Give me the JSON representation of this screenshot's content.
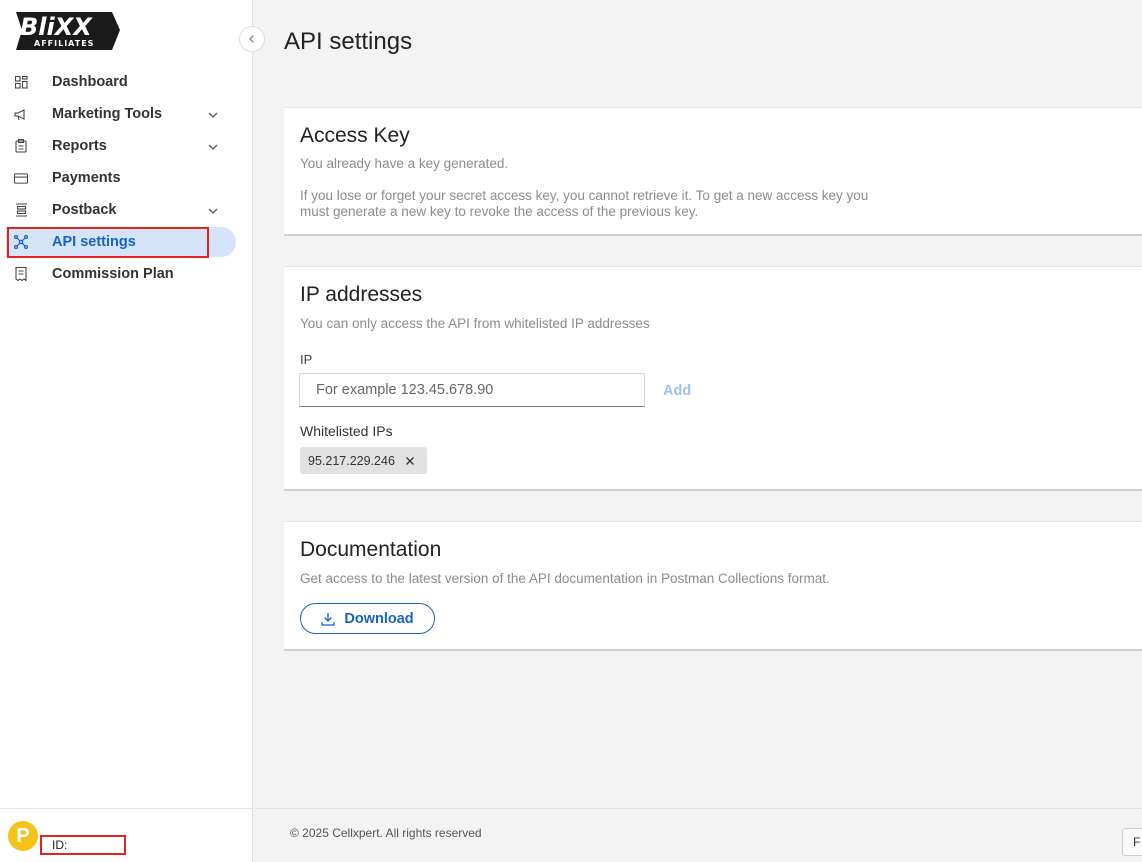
{
  "brand": {
    "logo_line1": "BliXX",
    "logo_line2": "AFFILIATES"
  },
  "sidebar": {
    "items": [
      {
        "label": "Dashboard",
        "icon": "dashboard-icon",
        "has_submenu": false
      },
      {
        "label": "Marketing Tools",
        "icon": "megaphone-icon",
        "has_submenu": true
      },
      {
        "label": "Reports",
        "icon": "clipboard-icon",
        "has_submenu": true
      },
      {
        "label": "Payments",
        "icon": "card-icon",
        "has_submenu": false
      },
      {
        "label": "Postback",
        "icon": "postback-icon",
        "has_submenu": true
      },
      {
        "label": "API settings",
        "icon": "network-icon",
        "has_submenu": false,
        "active": true
      },
      {
        "label": "Commission Plan",
        "icon": "document-icon",
        "has_submenu": false
      }
    ],
    "user": {
      "avatar_letter": "P",
      "id_label": "ID: "
    }
  },
  "page": {
    "title": "API settings"
  },
  "access_key": {
    "title": "Access Key",
    "status": "You already have a key generated.",
    "info_line1": "If you lose or forget your secret access key, you cannot retrieve it. To get a new access key you",
    "info_line2": "must generate a new key to revoke the access of the previous key."
  },
  "ip_addresses": {
    "title": "IP addresses",
    "description": "You can only access the API from whitelisted IP addresses",
    "ip_label": "IP",
    "ip_value": "",
    "ip_placeholder": "For example 123.45.678.90",
    "add_label": "Add",
    "whitelisted_label": "Whitelisted IPs",
    "whitelisted": [
      "95.217.229.246"
    ]
  },
  "documentation": {
    "title": "Documentation",
    "description": "Get access to the latest version of the API documentation in Postman Collections format.",
    "download_label": "Download"
  },
  "footer": {
    "copyright": "© 2025 Cellxpert. All rights reserved",
    "corner_button": "F"
  },
  "colors": {
    "accent": "#1a62c6",
    "active_bg": "#d6e4fa",
    "highlight": "#e0261a",
    "avatar": "#f6c31a"
  }
}
